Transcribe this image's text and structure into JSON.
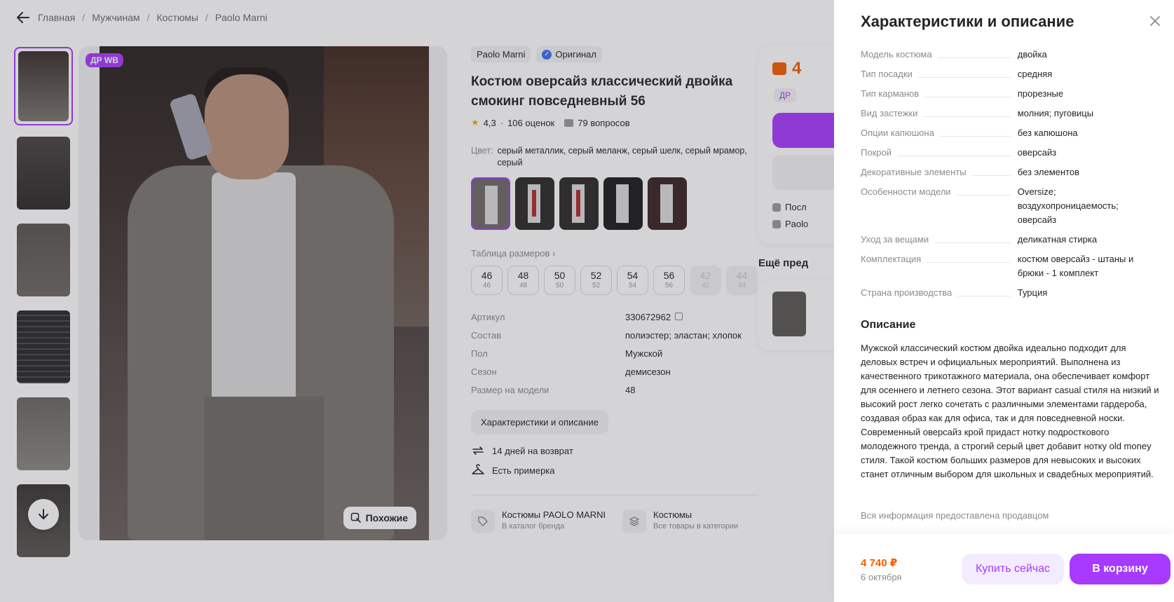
{
  "breadcrumbs": [
    "Главная",
    "Мужчинам",
    "Костюмы",
    "Paolo Marni"
  ],
  "gallery": {
    "badge": "ДР WB",
    "similar_label": "Похожие"
  },
  "product": {
    "brand": "Paolo Marni",
    "original_label": "Оригинал",
    "title": "Костюм оверсайз классический двойка смокинг повседневный 56",
    "rating": "4,3",
    "reviews": "106 оценок",
    "questions": "79 вопросов",
    "color_key": "Цвет:",
    "color_value": "серый металлик, серый меланж, серый шелк, серый мрамор, серый",
    "size_table_link": "Таблица размеров",
    "sizes": [
      {
        "ru": "46",
        "eu": "46",
        "available": true
      },
      {
        "ru": "48",
        "eu": "48",
        "available": true
      },
      {
        "ru": "50",
        "eu": "50",
        "available": true
      },
      {
        "ru": "52",
        "eu": "52",
        "available": true
      },
      {
        "ru": "54",
        "eu": "54",
        "available": true
      },
      {
        "ru": "56",
        "eu": "56",
        "available": true
      },
      {
        "ru": "42",
        "eu": "42",
        "available": false
      },
      {
        "ru": "44",
        "eu": "44",
        "available": false
      }
    ],
    "params": [
      {
        "k": "Артикул",
        "v": "330672962"
      },
      {
        "k": "Состав",
        "v": "полиэстер; эластан; хлопок"
      },
      {
        "k": "Пол",
        "v": "Мужской"
      },
      {
        "k": "Сезон",
        "v": "демисезон"
      },
      {
        "k": "Размер на модели",
        "v": "48"
      }
    ],
    "details_button": "Характеристики и описание",
    "return_text": "14 дней на возврат",
    "fitting_text": "Есть примерка",
    "brand_link": {
      "title": "Костюмы PAOLO MARNI",
      "sub": "В каталог бренда"
    },
    "category_link": {
      "title": "Костюмы",
      "sub": "Все товары в категории"
    }
  },
  "buybox": {
    "price_partial": "4",
    "dr_partial": "ДР",
    "row1": "Посл",
    "row2": "Paolo"
  },
  "more_title": "Ещё пред",
  "drawer": {
    "title": "Характеристики и описание",
    "chars": [
      {
        "k": "Модель костюма",
        "v": "двойка"
      },
      {
        "k": "Тип посадки",
        "v": "средняя"
      },
      {
        "k": "Тип карманов",
        "v": "прорезные"
      },
      {
        "k": "Вид застежки",
        "v": "молния; пуговицы"
      },
      {
        "k": "Опции капюшона",
        "v": "без капюшона"
      },
      {
        "k": "Покрой",
        "v": "оверсайз"
      },
      {
        "k": "Декоративные элементы",
        "v": "без элементов"
      },
      {
        "k": "Особенности модели",
        "v": "Oversize; воздухопроницаемость; оверсайз"
      },
      {
        "k": "Уход за вещами",
        "v": "деликатная стирка"
      },
      {
        "k": "Комплектация",
        "v": "костюм оверсайз - штаны и брюки - 1 комплект"
      },
      {
        "k": "Страна производства",
        "v": "Турция"
      }
    ],
    "desc_title": "Описание",
    "desc_text": "Мужской классический костюм двойка идеально подходит для деловых встреч и официальных мероприятий. Выполнена из качественного трикотажного материала, она обеспечивает комфорт для осеннего и летнего сезона. Этот вариант casual стиля на низкий и высокий рост легко сочетать с различными элементами гардероба, создавая образ как для офиса, так и для повседневной носки. Современный оверсайз крой придаст нотку подросткового молодежного тренда, а строгий серый цвет добавит нотку old money стиля. Такой костюм больших размеров для невысоких и высоких станет отличным выбором для школьных и свадебных мероприятий.",
    "seller_note": "Вся информация предоставлена продавцом",
    "price": "4 740 ₽",
    "date": "6 октября",
    "buy_now": "Купить сейчас",
    "to_cart": "В корзину"
  },
  "colors": {
    "accent": "#a73afd",
    "price": "#f55d00"
  }
}
